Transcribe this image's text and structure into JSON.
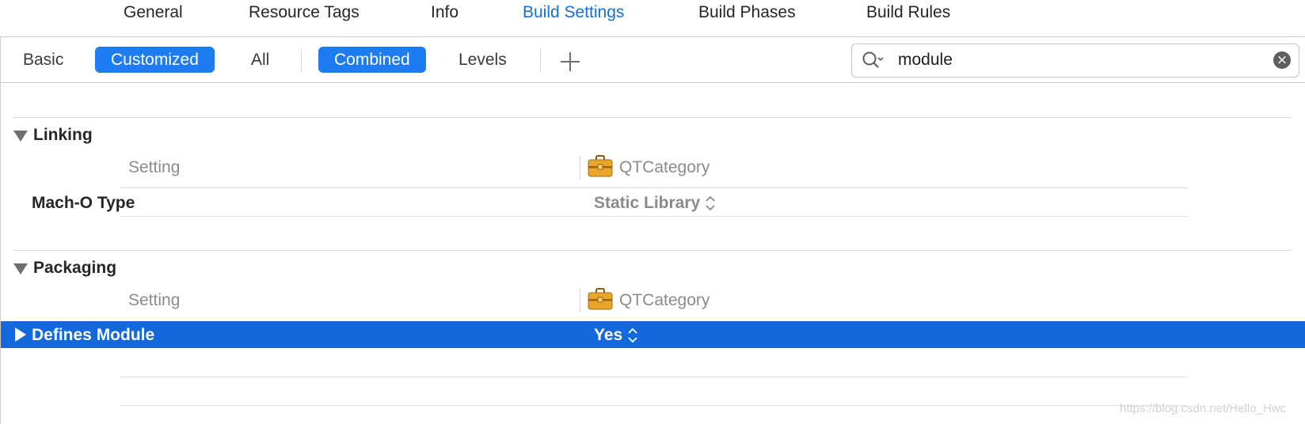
{
  "tabs": {
    "general": "General",
    "resource_tags": "Resource Tags",
    "info": "Info",
    "build_settings": "Build Settings",
    "build_phases": "Build Phases",
    "build_rules": "Build Rules"
  },
  "filter": {
    "basic": "Basic",
    "customized": "Customized",
    "all": "All",
    "combined": "Combined",
    "levels": "Levels"
  },
  "search": {
    "value": "module"
  },
  "sections": [
    {
      "title": "Linking",
      "header_label": "Setting",
      "target": "QTCategory",
      "row": {
        "name": "Mach-O Type",
        "value": "Static Library"
      }
    },
    {
      "title": "Packaging",
      "header_label": "Setting",
      "target": "QTCategory",
      "row": {
        "name": "Defines Module",
        "value": "Yes"
      }
    }
  ],
  "watermark": "https://blog.csdn.net/Hello_Hwc",
  "colors": {
    "accent": "#1e7cf2",
    "selection": "#1369dc",
    "active_tab": "#1470d8"
  }
}
